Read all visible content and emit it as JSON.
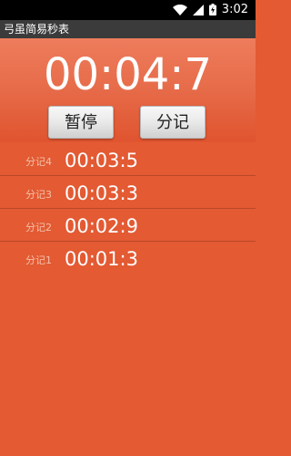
{
  "status_bar": {
    "time": "3:02",
    "icons": [
      "wifi-icon",
      "signal-icon",
      "battery-icon"
    ]
  },
  "app": {
    "title": "弓虽简易秒表"
  },
  "timer": {
    "display": "00:04:7"
  },
  "buttons": {
    "pause_label": "暂停",
    "split_label": "分记"
  },
  "splits": [
    {
      "label": "分记4",
      "time": "00:03:5"
    },
    {
      "label": "分记3",
      "time": "00:03:3"
    },
    {
      "label": "分记2",
      "time": "00:02:9"
    },
    {
      "label": "分记1",
      "time": "00:01:3"
    }
  ],
  "colors": {
    "background": "#e35a33",
    "header_top": "#ee7c5c",
    "title_bar": "#3b3b3b",
    "split_label": "#f4c0a8"
  }
}
